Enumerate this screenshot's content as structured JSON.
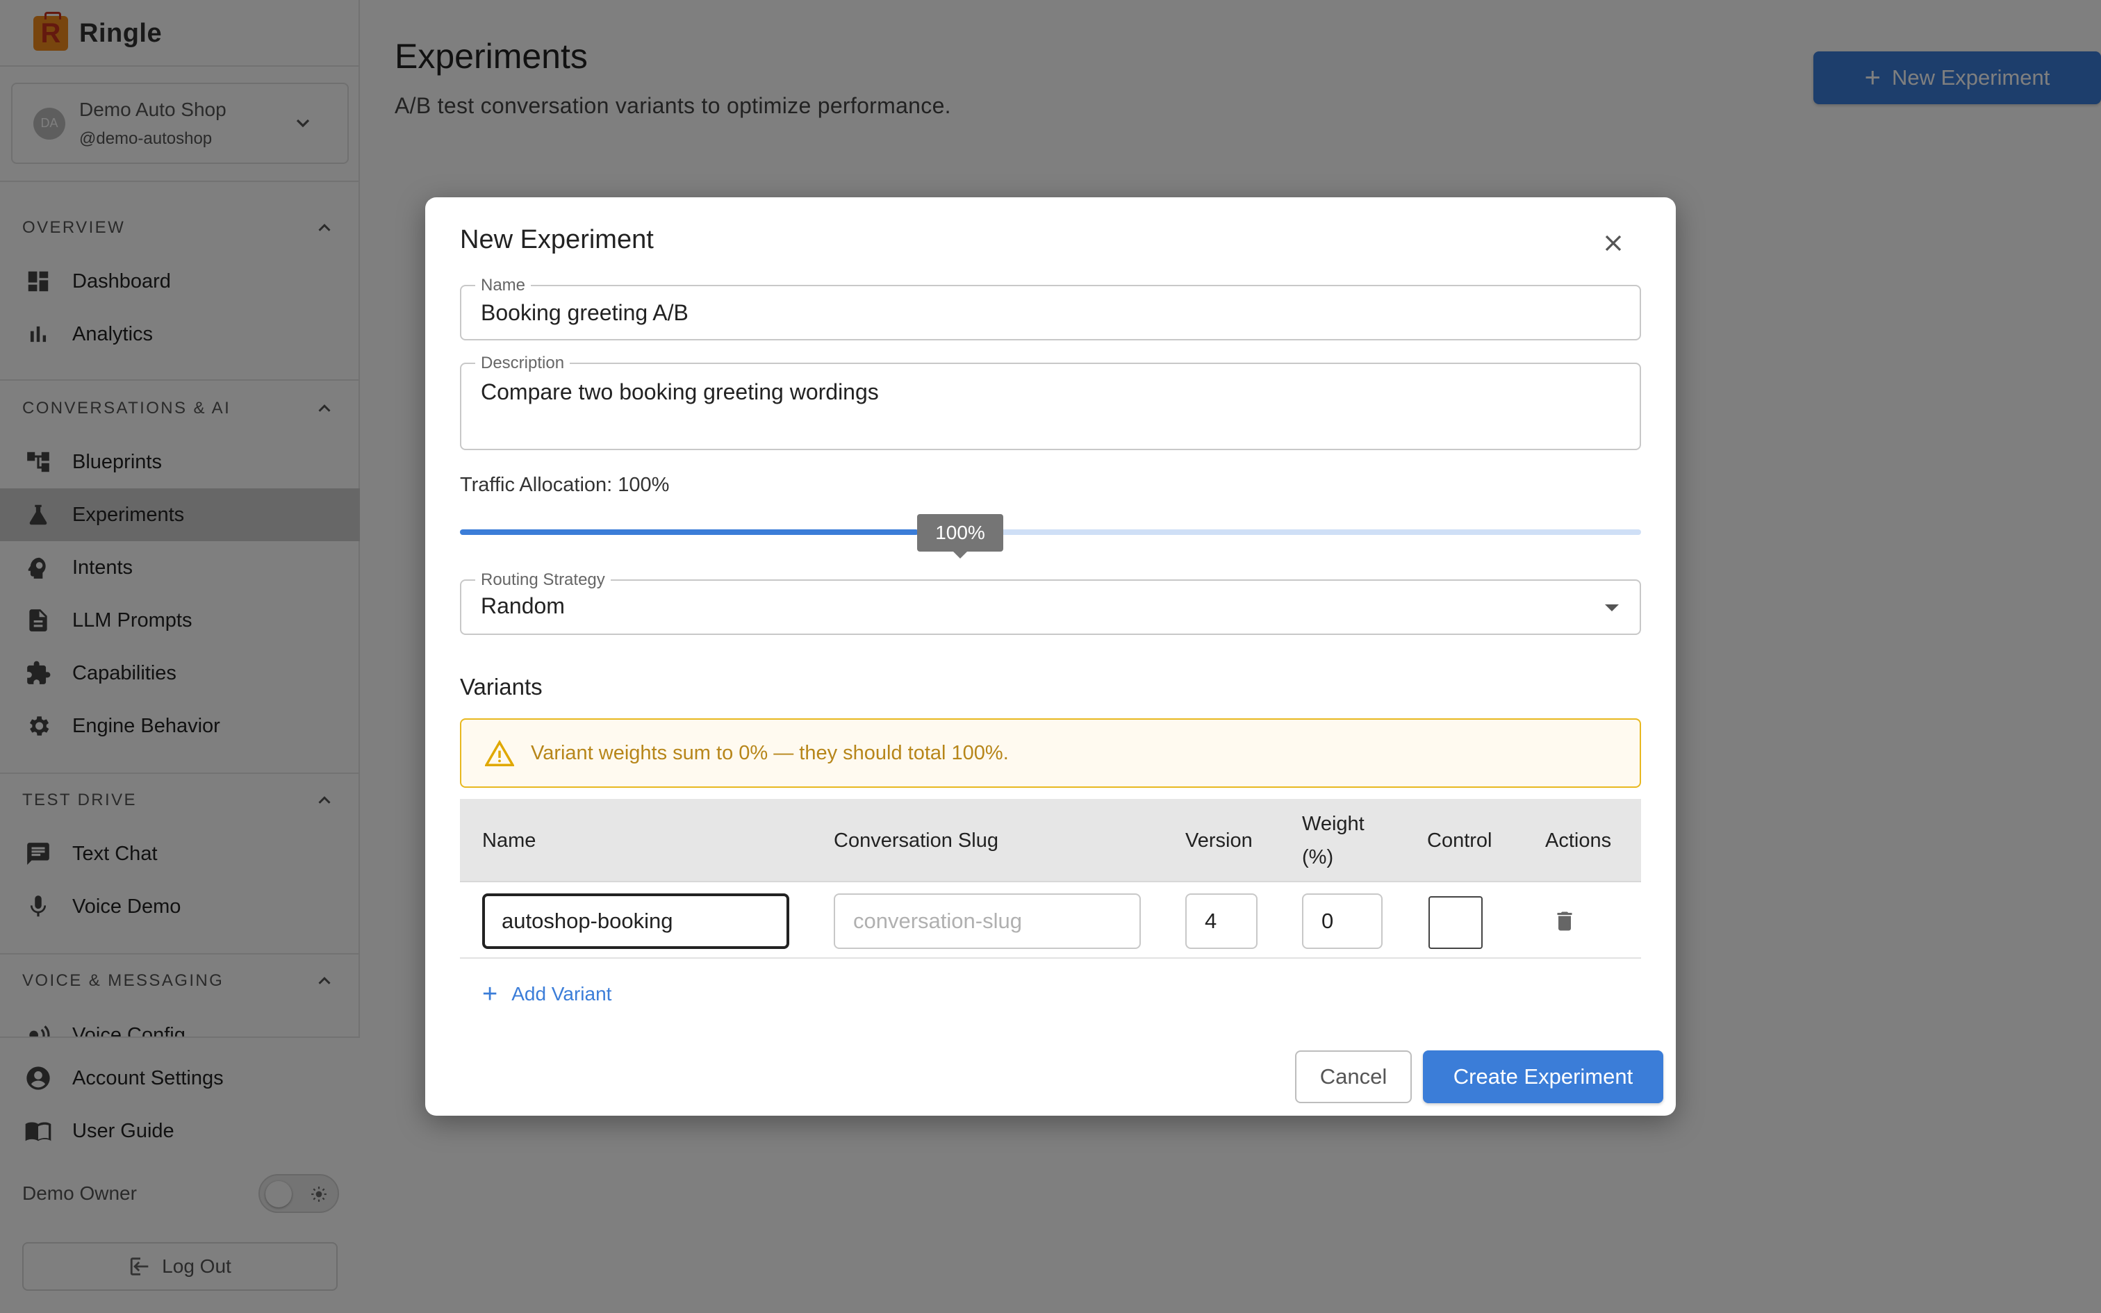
{
  "app": {
    "name": "Ringle"
  },
  "account": {
    "initials": "DA",
    "name": "Demo Auto Shop",
    "handle": "@demo-autoshop"
  },
  "sidebar": {
    "sections": [
      {
        "title": "OVERVIEW",
        "items": [
          {
            "label": "Dashboard",
            "icon": "dashboard-icon"
          },
          {
            "label": "Analytics",
            "icon": "bar-chart-icon"
          }
        ]
      },
      {
        "title": "CONVERSATIONS & AI",
        "items": [
          {
            "label": "Blueprints",
            "icon": "flow-tree-icon"
          },
          {
            "label": "Experiments",
            "icon": "flask-icon",
            "active": true
          },
          {
            "label": "Intents",
            "icon": "brain-icon"
          },
          {
            "label": "LLM Prompts",
            "icon": "document-icon"
          },
          {
            "label": "Capabilities",
            "icon": "puzzle-icon"
          },
          {
            "label": "Engine Behavior",
            "icon": "gear-icon"
          }
        ]
      },
      {
        "title": "TEST DRIVE",
        "items": [
          {
            "label": "Text Chat",
            "icon": "chat-icon"
          },
          {
            "label": "Voice Demo",
            "icon": "microphone-icon"
          }
        ]
      },
      {
        "title": "VOICE & MESSAGING",
        "items": [
          {
            "label": "Voice Config",
            "icon": "voice-icon"
          }
        ]
      }
    ],
    "bottom": {
      "account_settings": "Account Settings",
      "user_guide": "User Guide",
      "user_name": "Demo Owner",
      "logout": "Log Out"
    }
  },
  "page": {
    "title": "Experiments",
    "subtitle": "A/B test conversation variants to optimize performance.",
    "new_button": "New Experiment"
  },
  "dialog": {
    "title": "New Experiment",
    "name_label": "Name",
    "name_value": "Booking greeting A/B",
    "description_label": "Description",
    "description_value": "Compare two booking greeting wordings",
    "traffic_label": "Traffic Allocation: 100%",
    "traffic_value": 100,
    "traffic_tooltip": "100%",
    "routing_label": "Routing Strategy",
    "routing_value": "Random",
    "variants_title": "Variants",
    "warning": "Variant weights sum to 0% — they should total 100%.",
    "columns": {
      "name": "Name",
      "slug": "Conversation Slug",
      "version": "Version",
      "weight": "Weight (%)",
      "control": "Control",
      "actions": "Actions"
    },
    "rows": [
      {
        "name": "autoshop-booking",
        "slug_placeholder": "conversation-slug",
        "version": "4",
        "weight": "0",
        "control": false
      }
    ],
    "add_variant": "Add Variant",
    "cancel": "Cancel",
    "create": "Create Experiment"
  },
  "colors": {
    "accent": "#3b7dd8",
    "warning": "#e8b820",
    "active_nav": "#cfcfcf"
  }
}
